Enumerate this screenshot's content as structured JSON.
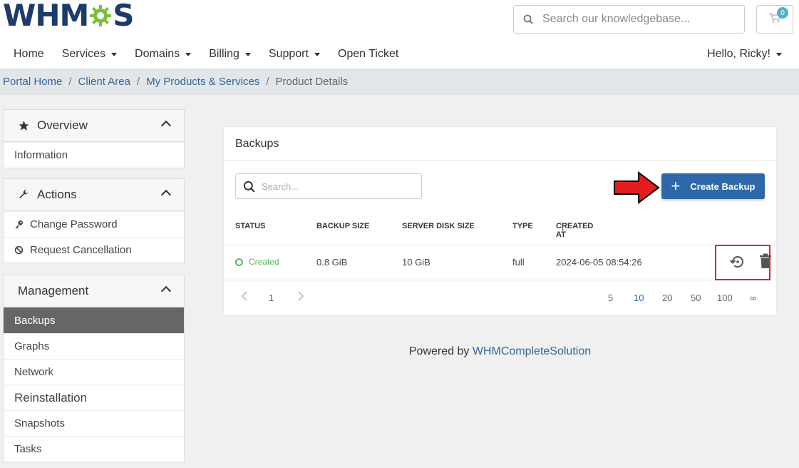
{
  "header": {
    "logo_text_left": "WHM",
    "logo_text_right": "S",
    "search_placeholder": "Search our knowledgebase...",
    "cart_count": "0"
  },
  "nav": {
    "items": [
      {
        "label": "Home",
        "dropdown": false
      },
      {
        "label": "Services",
        "dropdown": true
      },
      {
        "label": "Domains",
        "dropdown": true
      },
      {
        "label": "Billing",
        "dropdown": true
      },
      {
        "label": "Support",
        "dropdown": true
      },
      {
        "label": "Open Ticket",
        "dropdown": false
      }
    ],
    "user_greeting": "Hello, Ricky!"
  },
  "breadcrumb": {
    "items": [
      "Portal Home",
      "Client Area",
      "My Products & Services"
    ],
    "current": "Product Details",
    "sep": "/"
  },
  "sidebar": {
    "overview": {
      "title": "Overview",
      "items": [
        "Information"
      ]
    },
    "actions": {
      "title": "Actions",
      "items": [
        "Change Password",
        "Request Cancellation"
      ]
    },
    "management": {
      "title": "Management",
      "items": [
        "Backups",
        "Graphs",
        "Network",
        "Reinstallation",
        "Snapshots",
        "Tasks"
      ],
      "active": "Backups"
    }
  },
  "backups": {
    "title": "Backups",
    "search_placeholder": "Search...",
    "create_label": "Create Backup",
    "columns": [
      "STATUS",
      "BACKUP SIZE",
      "SERVER DISK SIZE",
      "TYPE",
      "CREATED AT"
    ],
    "sort_indicator": "↓",
    "rows": [
      {
        "status": "Created",
        "backup_size": "0.8 GiB",
        "server_disk_size": "10 GiB",
        "type": "full",
        "created_at": "2024-06-05 08:54:26"
      }
    ],
    "pagination": {
      "current_page": "1",
      "page_sizes": [
        "5",
        "10",
        "20",
        "50",
        "100",
        "∞"
      ],
      "active_size": "10"
    }
  },
  "footer": {
    "prefix": "Powered by",
    "link": "WHMCompleteSolution"
  },
  "colors": {
    "brand": "#1c3a6b",
    "accent": "#2e68a8",
    "success": "#5cb85c",
    "highlight": "#d9232e",
    "arrow": "#e31d1d"
  }
}
